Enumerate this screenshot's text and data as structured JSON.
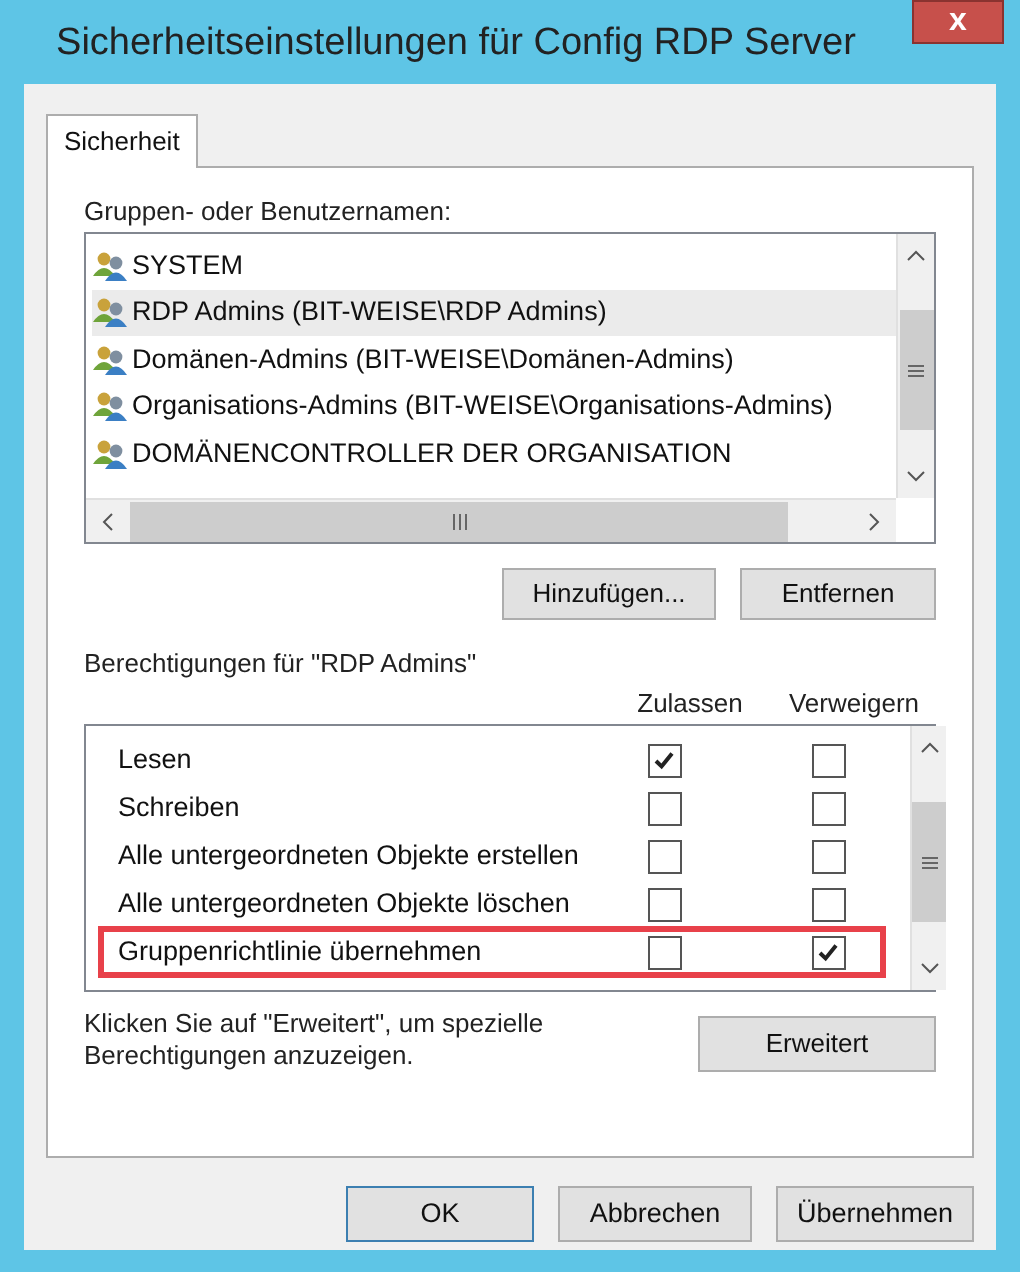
{
  "window": {
    "title": "Sicherheitseinstellungen für Config RDP Server",
    "close": "x"
  },
  "tabs": [
    {
      "label": "Sicherheit",
      "selected": true
    }
  ],
  "groups_label": "Gruppen- oder Benutzernamen:",
  "groups": [
    {
      "name": "SYSTEM",
      "selected": false
    },
    {
      "name": "RDP Admins (BIT-WEISE\\RDP Admins)",
      "selected": true
    },
    {
      "name": "Domänen-Admins (BIT-WEISE\\Domänen-Admins)",
      "selected": false
    },
    {
      "name": "Organisations-Admins (BIT-WEISE\\Organisations-Admins)",
      "selected": false
    },
    {
      "name": "DOMÄNENCONTROLLER DER ORGANISATION",
      "selected": false
    }
  ],
  "group_buttons": [
    "Hinzufügen...",
    "Entfernen"
  ],
  "permissions_label": "Berechtigungen für \"RDP Admins\"",
  "permission_columns": [
    "Zulassen",
    "Verweigern"
  ],
  "permissions": [
    {
      "name": "Lesen",
      "allow": true,
      "deny": false,
      "highlighted": false
    },
    {
      "name": "Schreiben",
      "allow": false,
      "deny": false,
      "highlighted": false
    },
    {
      "name": "Alle untergeordneten Objekte erstellen",
      "allow": false,
      "deny": false,
      "highlighted": false
    },
    {
      "name": "Alle untergeordneten Objekte löschen",
      "allow": false,
      "deny": false,
      "highlighted": false
    },
    {
      "name": "Gruppenrichtlinie übernehmen",
      "allow": false,
      "deny": true,
      "highlighted": true
    }
  ],
  "advanced_hint": "Klicken Sie auf \"Erweitert\", um spezielle Berechtigungen anzuzeigen.",
  "advanced_button": "Erweitert",
  "buttons": [
    "OK",
    "Abbrechen",
    "Übernehmen"
  ]
}
